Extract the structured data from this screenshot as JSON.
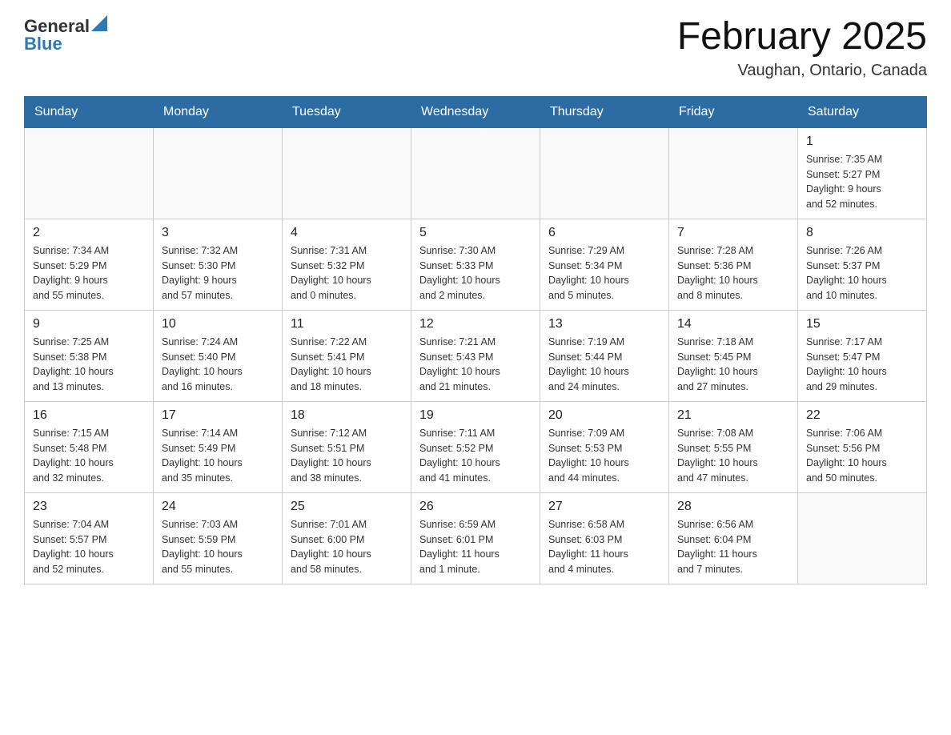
{
  "header": {
    "logo_general": "General",
    "logo_blue": "Blue",
    "title": "February 2025",
    "subtitle": "Vaughan, Ontario, Canada"
  },
  "weekdays": [
    "Sunday",
    "Monday",
    "Tuesday",
    "Wednesday",
    "Thursday",
    "Friday",
    "Saturday"
  ],
  "weeks": [
    [
      {
        "day": "",
        "info": ""
      },
      {
        "day": "",
        "info": ""
      },
      {
        "day": "",
        "info": ""
      },
      {
        "day": "",
        "info": ""
      },
      {
        "day": "",
        "info": ""
      },
      {
        "day": "",
        "info": ""
      },
      {
        "day": "1",
        "info": "Sunrise: 7:35 AM\nSunset: 5:27 PM\nDaylight: 9 hours\nand 52 minutes."
      }
    ],
    [
      {
        "day": "2",
        "info": "Sunrise: 7:34 AM\nSunset: 5:29 PM\nDaylight: 9 hours\nand 55 minutes."
      },
      {
        "day": "3",
        "info": "Sunrise: 7:32 AM\nSunset: 5:30 PM\nDaylight: 9 hours\nand 57 minutes."
      },
      {
        "day": "4",
        "info": "Sunrise: 7:31 AM\nSunset: 5:32 PM\nDaylight: 10 hours\nand 0 minutes."
      },
      {
        "day": "5",
        "info": "Sunrise: 7:30 AM\nSunset: 5:33 PM\nDaylight: 10 hours\nand 2 minutes."
      },
      {
        "day": "6",
        "info": "Sunrise: 7:29 AM\nSunset: 5:34 PM\nDaylight: 10 hours\nand 5 minutes."
      },
      {
        "day": "7",
        "info": "Sunrise: 7:28 AM\nSunset: 5:36 PM\nDaylight: 10 hours\nand 8 minutes."
      },
      {
        "day": "8",
        "info": "Sunrise: 7:26 AM\nSunset: 5:37 PM\nDaylight: 10 hours\nand 10 minutes."
      }
    ],
    [
      {
        "day": "9",
        "info": "Sunrise: 7:25 AM\nSunset: 5:38 PM\nDaylight: 10 hours\nand 13 minutes."
      },
      {
        "day": "10",
        "info": "Sunrise: 7:24 AM\nSunset: 5:40 PM\nDaylight: 10 hours\nand 16 minutes."
      },
      {
        "day": "11",
        "info": "Sunrise: 7:22 AM\nSunset: 5:41 PM\nDaylight: 10 hours\nand 18 minutes."
      },
      {
        "day": "12",
        "info": "Sunrise: 7:21 AM\nSunset: 5:43 PM\nDaylight: 10 hours\nand 21 minutes."
      },
      {
        "day": "13",
        "info": "Sunrise: 7:19 AM\nSunset: 5:44 PM\nDaylight: 10 hours\nand 24 minutes."
      },
      {
        "day": "14",
        "info": "Sunrise: 7:18 AM\nSunset: 5:45 PM\nDaylight: 10 hours\nand 27 minutes."
      },
      {
        "day": "15",
        "info": "Sunrise: 7:17 AM\nSunset: 5:47 PM\nDaylight: 10 hours\nand 29 minutes."
      }
    ],
    [
      {
        "day": "16",
        "info": "Sunrise: 7:15 AM\nSunset: 5:48 PM\nDaylight: 10 hours\nand 32 minutes."
      },
      {
        "day": "17",
        "info": "Sunrise: 7:14 AM\nSunset: 5:49 PM\nDaylight: 10 hours\nand 35 minutes."
      },
      {
        "day": "18",
        "info": "Sunrise: 7:12 AM\nSunset: 5:51 PM\nDaylight: 10 hours\nand 38 minutes."
      },
      {
        "day": "19",
        "info": "Sunrise: 7:11 AM\nSunset: 5:52 PM\nDaylight: 10 hours\nand 41 minutes."
      },
      {
        "day": "20",
        "info": "Sunrise: 7:09 AM\nSunset: 5:53 PM\nDaylight: 10 hours\nand 44 minutes."
      },
      {
        "day": "21",
        "info": "Sunrise: 7:08 AM\nSunset: 5:55 PM\nDaylight: 10 hours\nand 47 minutes."
      },
      {
        "day": "22",
        "info": "Sunrise: 7:06 AM\nSunset: 5:56 PM\nDaylight: 10 hours\nand 50 minutes."
      }
    ],
    [
      {
        "day": "23",
        "info": "Sunrise: 7:04 AM\nSunset: 5:57 PM\nDaylight: 10 hours\nand 52 minutes."
      },
      {
        "day": "24",
        "info": "Sunrise: 7:03 AM\nSunset: 5:59 PM\nDaylight: 10 hours\nand 55 minutes."
      },
      {
        "day": "25",
        "info": "Sunrise: 7:01 AM\nSunset: 6:00 PM\nDaylight: 10 hours\nand 58 minutes."
      },
      {
        "day": "26",
        "info": "Sunrise: 6:59 AM\nSunset: 6:01 PM\nDaylight: 11 hours\nand 1 minute."
      },
      {
        "day": "27",
        "info": "Sunrise: 6:58 AM\nSunset: 6:03 PM\nDaylight: 11 hours\nand 4 minutes."
      },
      {
        "day": "28",
        "info": "Sunrise: 6:56 AM\nSunset: 6:04 PM\nDaylight: 11 hours\nand 7 minutes."
      },
      {
        "day": "",
        "info": ""
      }
    ]
  ]
}
